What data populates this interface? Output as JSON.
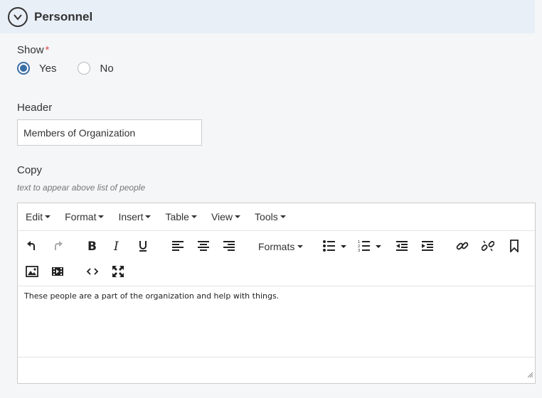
{
  "section": {
    "title": "Personnel",
    "toggle_icon": "chevron-down-icon"
  },
  "show_field": {
    "label": "Show",
    "required_mark": "*",
    "options": [
      {
        "label": "Yes",
        "selected": true
      },
      {
        "label": "No",
        "selected": false
      }
    ]
  },
  "header_field": {
    "label": "Header",
    "value": "Members of Organization"
  },
  "copy_field": {
    "label": "Copy",
    "helper": "text to appear above list of people"
  },
  "editor": {
    "menus": [
      "Edit",
      "Format",
      "Insert",
      "Table",
      "View",
      "Tools"
    ],
    "toolbar": {
      "formats_label": "Formats",
      "icons": [
        "undo-icon",
        "redo-icon",
        "bold-icon",
        "italic-icon",
        "underline-icon",
        "align-left-icon",
        "align-center-icon",
        "align-right-icon",
        "bullet-list-icon",
        "numbered-list-icon",
        "outdent-icon",
        "indent-icon",
        "link-icon",
        "unlink-icon",
        "bookmark-icon",
        "image-icon",
        "media-icon",
        "code-icon",
        "fullscreen-icon"
      ]
    },
    "content": "These people are a part of the organization and help with things."
  },
  "colors": {
    "header_bg": "#e9eff7",
    "accent": "#3b6ea5",
    "required": "#d9534f"
  }
}
